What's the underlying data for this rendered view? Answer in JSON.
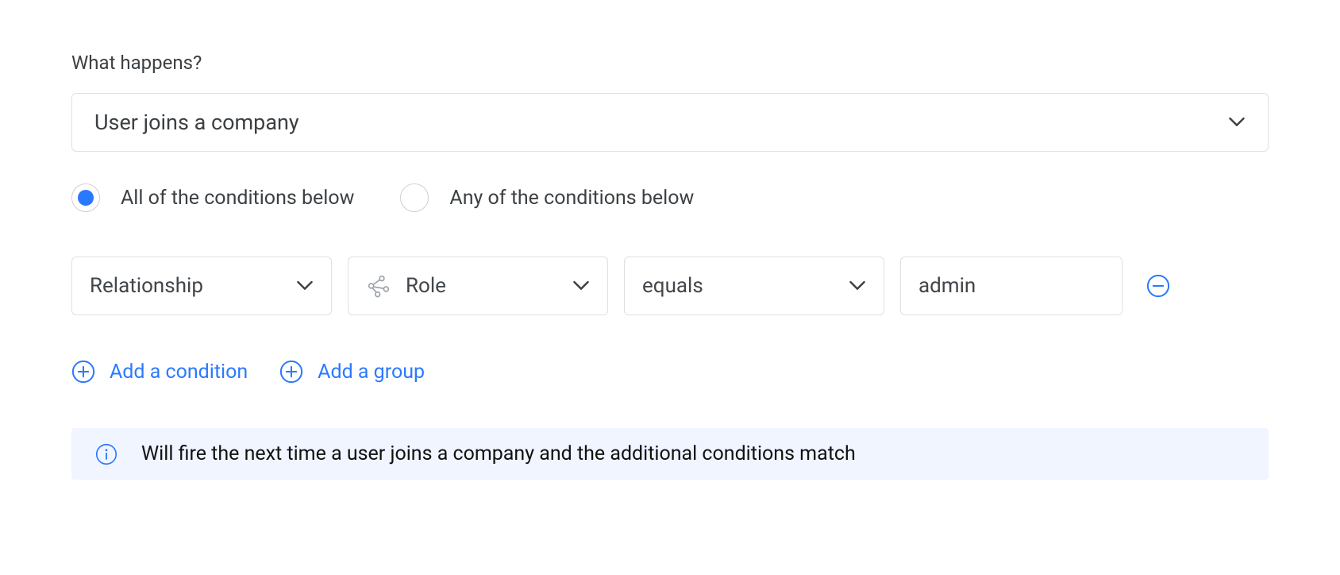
{
  "header": {
    "label": "What happens?"
  },
  "trigger": {
    "value": "User joins a company"
  },
  "matchMode": {
    "options": [
      {
        "label": "All of the conditions below",
        "checked": true
      },
      {
        "label": "Any of the conditions below",
        "checked": false
      }
    ]
  },
  "condition": {
    "field": "Relationship",
    "attribute": "Role",
    "operator": "equals",
    "value": "admin"
  },
  "actions": {
    "addCondition": "Add a condition",
    "addGroup": "Add a group"
  },
  "info": {
    "text": "Will fire the next time a user joins a company and the additional conditions match"
  }
}
